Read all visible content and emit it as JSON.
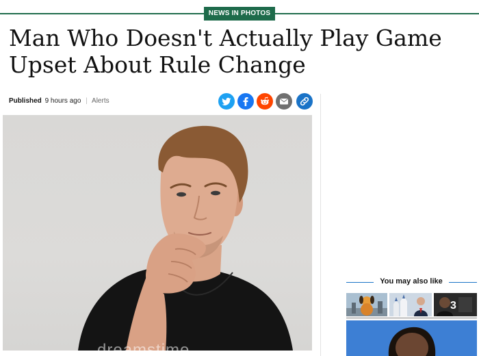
{
  "section": {
    "tag": "NEWS IN PHOTOS"
  },
  "article": {
    "headline": "Man Who Doesn't Actually Play Game Upset About Rule Change",
    "published_label": "Published",
    "time_ago": "9 hours ago",
    "separator": "|",
    "alerts_label": "Alerts",
    "photo_watermark": "dreamstime"
  },
  "share": [
    {
      "name": "twitter-icon",
      "color": "#1da1f2"
    },
    {
      "name": "facebook-icon",
      "color": "#1877f2"
    },
    {
      "name": "reddit-icon",
      "color": "#ff4500"
    },
    {
      "name": "email-icon",
      "color": "#707070"
    },
    {
      "name": "link-icon",
      "color": "#1a73c7"
    }
  ],
  "sidebar": {
    "title": "You may also like",
    "thumb_count": "3"
  },
  "colors": {
    "accent": "#1e6b4b",
    "link": "#1a73c7"
  }
}
